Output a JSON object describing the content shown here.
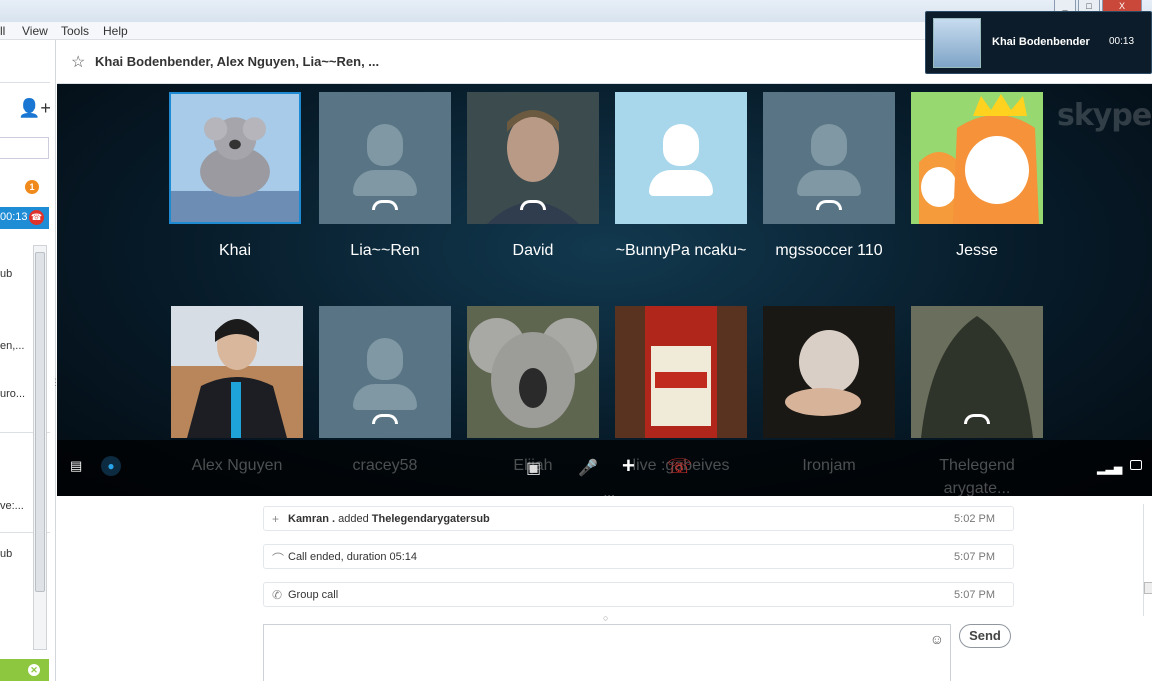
{
  "menu": {
    "items": [
      "ll",
      "View",
      "Tools",
      "Help"
    ]
  },
  "window": {
    "minimize": "_",
    "maximize": "□",
    "close": "X"
  },
  "conversation": {
    "title": "Khai Bodenbender, Alex Nguyen, Lia~~Ren, ..."
  },
  "mini_call": {
    "name": "Khai Bodenbender",
    "duration": "00:13"
  },
  "sidebar": {
    "notification_count": "1",
    "active_call_time": "00:13",
    "snippets": [
      "ub",
      "en,...",
      "uro...",
      "ve:...",
      "ub"
    ]
  },
  "participants_row1": [
    {
      "name": "Khai"
    },
    {
      "name": "Lia~~Ren"
    },
    {
      "name": "David"
    },
    {
      "name": "~BunnyPa ncaku~"
    },
    {
      "name": "mgssoccer 110"
    },
    {
      "name": "Jesse"
    }
  ],
  "participants_row2": [
    {
      "name": "Alex Nguyen"
    },
    {
      "name": "cracey58"
    },
    {
      "name": "Elijah"
    },
    {
      "name": "live :gabeives"
    },
    {
      "name": "Ironjam"
    },
    {
      "name": "Thelegend arygate..."
    }
  ],
  "logo": {
    "text": "skype"
  },
  "chat": {
    "messages": [
      {
        "icon": "+",
        "actor": "Kamran .",
        "action": "added",
        "target": "Thelegendarygatersub",
        "time": "5:02 PM"
      },
      {
        "icon": "hangup",
        "text": "Call ended, duration 05:14",
        "time": "5:07 PM"
      },
      {
        "icon": "phone",
        "text": "Group call",
        "time": "5:07 PM"
      }
    ],
    "send_label": "Send"
  },
  "colors": {
    "accent": "#1f8cd6",
    "hangup_red": "#e0312b",
    "stage_bg": "#071b29"
  }
}
